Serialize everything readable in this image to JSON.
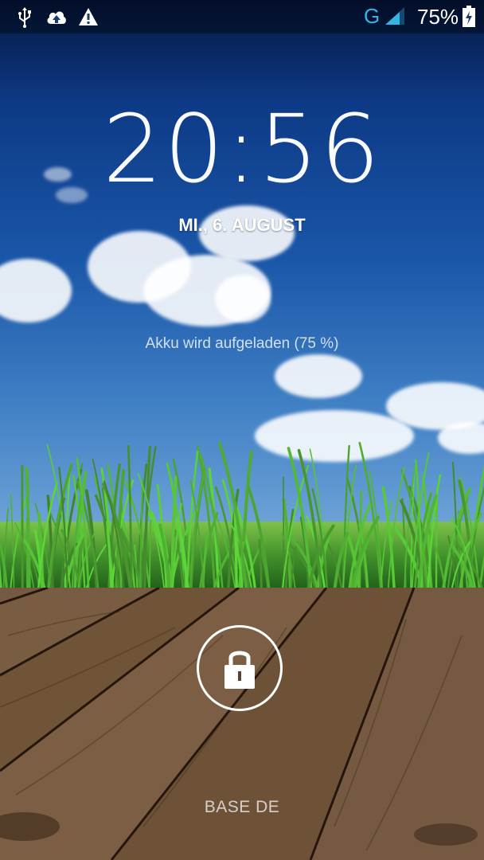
{
  "status_bar": {
    "left_icons": [
      "usb-icon",
      "cloud-upload-icon",
      "warning-icon"
    ],
    "network_type": "G",
    "battery_percent": "75%",
    "network_color": "#33b5e5"
  },
  "lockscreen": {
    "time": "20:56",
    "date": "MI., 6. AUGUST",
    "charging_status": "Akku wird aufgeladen (75 %)",
    "lock_icon": "lock-icon",
    "carrier": "BASE DE"
  }
}
